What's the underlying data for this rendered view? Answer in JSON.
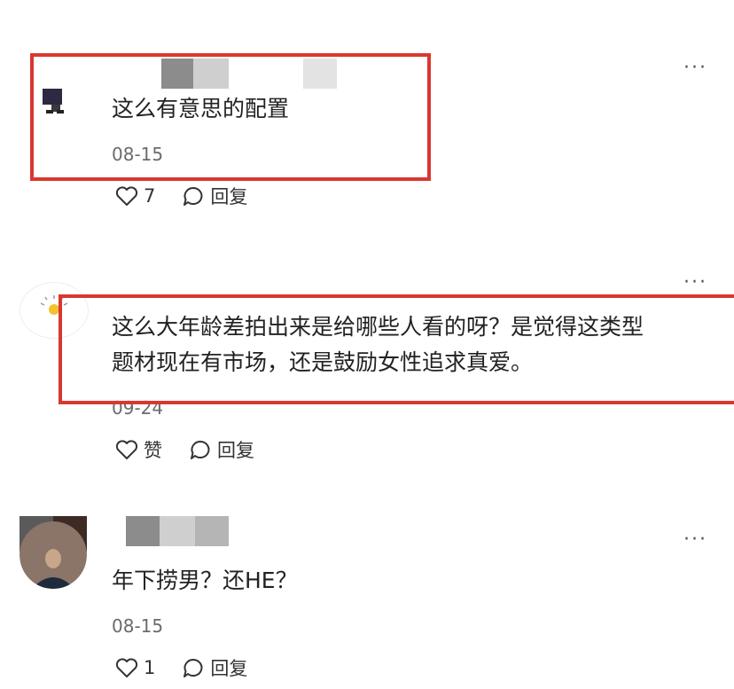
{
  "comments": [
    {
      "text": "这么有意思的配置",
      "date": "08-15",
      "like_label": "7",
      "reply_label": "回复"
    },
    {
      "text_line1": "这么大年龄差拍出来是给哪些人看的呀？是觉得这类型",
      "text_line2": "题材现在有市场，还是鼓励女性追求真爱。",
      "date": "09-24",
      "like_label": "赞",
      "reply_label": "回复"
    },
    {
      "text": "年下捞男？还HE？",
      "date": "08-15",
      "like_label": "1",
      "reply_label": "回复"
    }
  ],
  "more_label": "···",
  "colors": {
    "highlight": "#d9382f",
    "text": "#222222",
    "muted": "#6b6b6b"
  },
  "icons": [
    "heart-icon",
    "speech-bubble-icon",
    "more-icon"
  ]
}
